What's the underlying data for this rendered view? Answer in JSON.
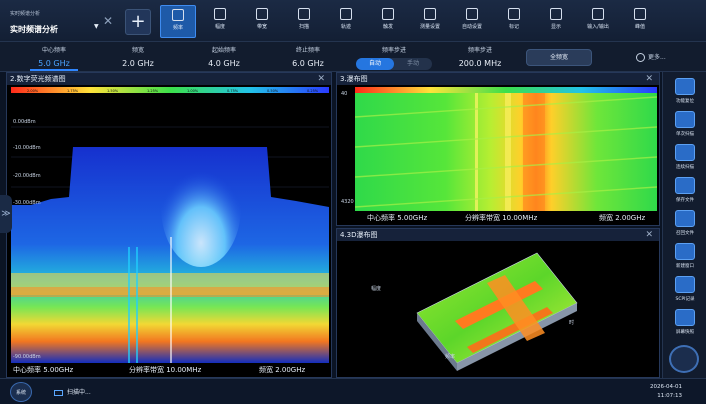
{
  "mode": {
    "small_label": "实时频谱分析",
    "main_label": "实时频谱分析"
  },
  "toolbar": {
    "tools": [
      {
        "label": "频率",
        "icon": "frequency-icon",
        "active": true
      },
      {
        "label": "幅度",
        "icon": "amplitude-icon",
        "active": false
      },
      {
        "label": "带宽",
        "icon": "bandwidth-icon",
        "active": false
      },
      {
        "label": "扫描",
        "icon": "sweep-icon",
        "active": false
      },
      {
        "label": "轨迹",
        "icon": "trace-icon",
        "active": false
      },
      {
        "label": "触发",
        "icon": "trigger-icon",
        "active": false
      },
      {
        "label": "测量设置",
        "icon": "measure-setup-icon",
        "active": false
      },
      {
        "label": "自动设置",
        "icon": "auto-setup-icon",
        "active": false
      },
      {
        "label": "标记",
        "icon": "marker-flag-icon",
        "active": false
      },
      {
        "label": "显示",
        "icon": "display-eye-icon",
        "active": false
      },
      {
        "label": "输入/输出",
        "icon": "io-icon",
        "active": false
      },
      {
        "label": "峰值",
        "icon": "peak-icon",
        "active": false
      }
    ]
  },
  "params": {
    "center": {
      "label": "中心频率",
      "value": "5.0 GHz"
    },
    "span": {
      "label": "频宽",
      "value": "2.0 GHz"
    },
    "start": {
      "label": "起始频率",
      "value": "4.0 GHz"
    },
    "stop": {
      "label": "终止频率",
      "value": "6.0 GHz"
    },
    "step_mode": {
      "label": "频率步进",
      "auto": "自动",
      "manual": "手动"
    },
    "step": {
      "label": "频率步进",
      "value": "200.0 MHz"
    },
    "full_span": "全频宽",
    "more": "更多..."
  },
  "panel_spectrum": {
    "title": "2.数字荧光频谱图",
    "y_ticks": [
      "0.00dBm",
      "-10.00dBm",
      "-20.00dBm",
      "-30.00dBm",
      "-90.00dBm"
    ],
    "footer": {
      "center": "中心频率 5.00GHz",
      "rbw": "分辨率带宽 10.00MHz",
      "span": "频宽 2.00GHz"
    },
    "colorbar_ticks": [
      "2.00%",
      "1.75%",
      "1.50%",
      "1.25%",
      "1.00%",
      "0.75%",
      "0.50%",
      "0.25%"
    ]
  },
  "panel_waterfall": {
    "title": "3.瀑布图",
    "y_top": "40",
    "y_bottom": "4320",
    "footer": {
      "center": "中心频率 5.00GHz",
      "rbw": "分辨率带宽 10.00MHz",
      "span": "频宽 2.00GHz"
    }
  },
  "panel_3d": {
    "title": "4.3D瀑布图",
    "axis_amp": "幅度",
    "axis_freq": "频率",
    "axis_time": "时"
  },
  "sidebar": {
    "items": [
      {
        "label": "功能复位",
        "icon": "preset-icon"
      },
      {
        "label": "单次扫描",
        "icon": "single-sweep-icon"
      },
      {
        "label": "连续扫描",
        "icon": "continuous-sweep-icon"
      },
      {
        "label": "保存文件",
        "icon": "save-file-icon"
      },
      {
        "label": "召回文件",
        "icon": "recall-folder-icon"
      },
      {
        "label": "新建窗口",
        "icon": "new-window-icon"
      },
      {
        "label": "SCPI记录",
        "icon": "scpi-log-icon"
      },
      {
        "label": "屏幕快照",
        "icon": "screenshot-icon"
      }
    ]
  },
  "status": {
    "home_label": "系统",
    "scan_text": "扫描中...",
    "date": "2026-04-01",
    "time": "11:07:13"
  },
  "colors": {
    "accent": "#2f86ff",
    "panel_bg": "#000000",
    "app_bg": "#0b1424"
  }
}
